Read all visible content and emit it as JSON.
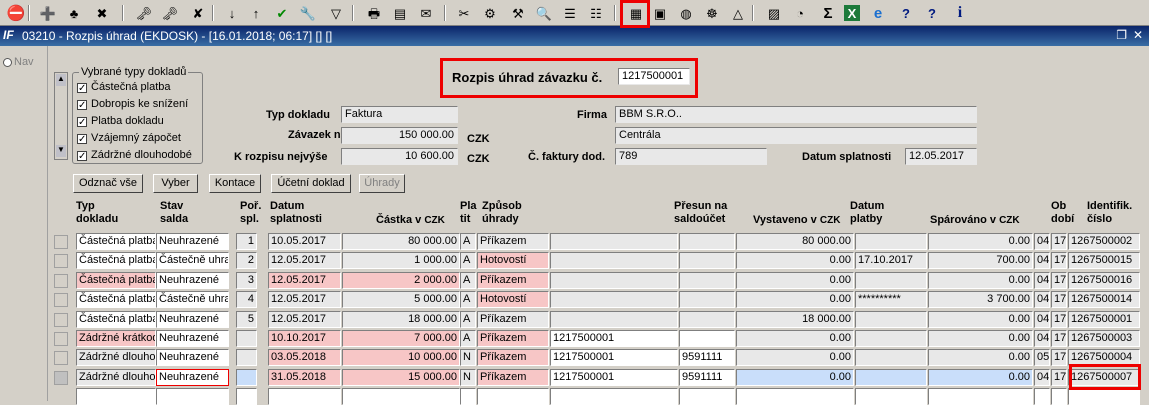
{
  "toolbar": {
    "items": [
      "exit-icon",
      "add-record-icon",
      "record-plus-icon",
      "delete-record-icon",
      "doc-key-icon",
      "doc-key2-icon",
      "doc-delete-icon",
      "sort-asc-icon",
      "sort-desc-icon",
      "checkmark-icon",
      "wrench-icon",
      "filter-icon",
      "print-icon",
      "copy-icon",
      "mail-icon",
      "scissors-icon",
      "gear-icon",
      "tools-icon",
      "find-icon",
      "list-icon",
      "tree-icon",
      "form-view-icon",
      "save-icon",
      "globe-icon",
      "wheel-icon",
      "triangle-icon",
      "chart-icon",
      "clock-icon",
      "sigma-icon",
      "excel-icon",
      "ie-icon",
      "help-icon",
      "question-icon",
      "info-icon"
    ]
  },
  "window": {
    "title": "03210 - Rozpis úhrad (EKDOSK) - [16.01.2018; 06:17] [] []",
    "logo": "IF"
  },
  "nav": {
    "label": "Nav"
  },
  "doc_types": {
    "title": "Vybrané typy dokladů",
    "items": [
      "Částečná platba",
      "Dobropis ke snížení",
      "Platba dokladu",
      "Vzájemný zápočet",
      "Zádržné dlouhodobé"
    ]
  },
  "header": {
    "title_label": "Rozpis úhrad závazku č.",
    "title_value": "1217500001",
    "typ_label": "Typ dokladu",
    "typ_value": "Faktura",
    "firma_label": "Firma",
    "firma_value": "BBM S.R.O..",
    "zavazek_label": "Závazek na",
    "zavazek_value": "150 000.00",
    "zavazek_cur": "CZK",
    "firma2_value": "Centrála",
    "krozpisu_label": "K rozpisu nejvýše",
    "krozpisu_value": "10 600.00",
    "krozpisu_cur": "CZK",
    "cfak_label": "Č. faktury dod.",
    "cfak_value": "789",
    "datsp_label": "Datum splatnosti",
    "datsp_value": "12.05.2017"
  },
  "buttons": {
    "odznac": "Odznač vše",
    "vyber": "Vyber",
    "kontace": "Kontace",
    "ucetni": "Účetní doklad",
    "uhrady": "Úhrady"
  },
  "columns": {
    "typ": "Typ\ndokladu",
    "stav": "Stav\nsalda",
    "por": "Poř.\nspl.",
    "datum": "Datum\nsplatnosti",
    "castka": "Částka v",
    "castka_cur": "CZK",
    "platit": "Pla\ntit",
    "zpusob": "Způsob\núhrady",
    "presun": "Přesun na\nsaldoúčet",
    "vystaveno": "Vystaveno v",
    "vystaveno_cur": "CZK",
    "datplat": "Datum\nplatby",
    "sparovano": "Spárováno v",
    "sparovano_cur": "CZK",
    "obdobi": "Ob\ndobí",
    "ident": "Identifik.\nčíslo"
  },
  "rows": [
    {
      "typ": "Částečná platba",
      "stav": "Neuhrazené",
      "por": "1",
      "datum": "10.05.2017",
      "castka": "80 000.00",
      "platit": "A",
      "zpusob": "Příkazem",
      "ref": "",
      "presun": "",
      "vystaveno": "80 000.00",
      "datplat": "",
      "sparovano": "0.00",
      "ob1": "04",
      "ob2": "17",
      "ident": "1267500002",
      "pink": false,
      "blue": false
    },
    {
      "typ": "Částečná platba",
      "stav": "Částečně uhra",
      "por": "2",
      "datum": "12.05.2017",
      "castka": "1 000.00",
      "platit": "A",
      "zpusob": "Hotovostí",
      "ref": "",
      "presun": "",
      "vystaveno": "0.00",
      "datplat": "17.10.2017",
      "sparovano": "700.00",
      "ob1": "04",
      "ob2": "17",
      "ident": "1267500015",
      "pink": false,
      "blue": false
    },
    {
      "typ": "Částečná platba",
      "stav": "Neuhrazené",
      "por": "3",
      "datum": "12.05.2017",
      "castka": "2 000.00",
      "platit": "A",
      "zpusob": "Příkazem",
      "ref": "",
      "presun": "",
      "vystaveno": "0.00",
      "datplat": "",
      "sparovano": "0.00",
      "ob1": "04",
      "ob2": "17",
      "ident": "1267500016",
      "pink": true,
      "blue": false
    },
    {
      "typ": "Částečná platba",
      "stav": "Částečně uhra",
      "por": "4",
      "datum": "12.05.2017",
      "castka": "5 000.00",
      "platit": "A",
      "zpusob": "Hotovostí",
      "ref": "",
      "presun": "",
      "vystaveno": "0.00",
      "datplat": "**********",
      "sparovano": "3 700.00",
      "ob1": "04",
      "ob2": "17",
      "ident": "1267500014",
      "pink": false,
      "blue": false
    },
    {
      "typ": "Částečná platba",
      "stav": "Neuhrazené",
      "por": "5",
      "datum": "12.05.2017",
      "castka": "18 000.00",
      "platit": "A",
      "zpusob": "Příkazem",
      "ref": "",
      "presun": "",
      "vystaveno": "18 000.00",
      "datplat": "",
      "sparovano": "0.00",
      "ob1": "04",
      "ob2": "17",
      "ident": "1267500001",
      "pink": false,
      "blue": false
    },
    {
      "typ": "Zádržné krátkod",
      "stav": "Neuhrazené",
      "por": "",
      "datum": "10.10.2017",
      "castka": "7 000.00",
      "platit": "A",
      "zpusob": "Příkazem",
      "ref": "1217500001",
      "presun": "",
      "vystaveno": "0.00",
      "datplat": "",
      "sparovano": "0.00",
      "ob1": "04",
      "ob2": "17",
      "ident": "1267500003",
      "pink": true,
      "blue": false
    },
    {
      "typ": "Zádržné dlouhod",
      "stav": "Neuhrazené",
      "por": "",
      "datum": "03.05.2018",
      "castka": "10 000.00",
      "platit": "N",
      "zpusob": "Příkazem",
      "ref": "1217500001",
      "presun": "9591111",
      "vystaveno": "0.00",
      "datplat": "",
      "sparovano": "0.00",
      "ob1": "05",
      "ob2": "17",
      "ident": "1267500004",
      "pink": true,
      "blue": false
    },
    {
      "typ": "Zádržné dlouhod",
      "stav": "Neuhrazené",
      "por": "",
      "datum": "31.05.2018",
      "castka": "15 000.00",
      "platit": "N",
      "zpusob": "Příkazem",
      "ref": "1217500001",
      "presun": "9591111",
      "vystaveno": "0.00",
      "datplat": "",
      "sparovano": "0.00",
      "ob1": "04",
      "ob2": "17",
      "ident": "1267500007",
      "pink": true,
      "blue": true
    }
  ]
}
